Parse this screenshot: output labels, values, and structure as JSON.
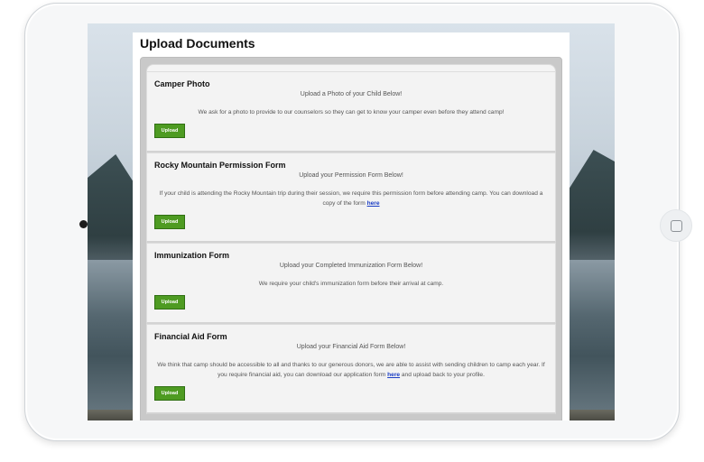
{
  "page": {
    "title": "Upload Documents"
  },
  "cards": [
    {
      "title": "Camper Photo",
      "subtitle": "Upload a Photo of your Child Below!",
      "desc_before": "We ask for a photo to provide to our counselors so they can get to know your camper even before they attend camp!",
      "link": "",
      "desc_after": "",
      "button": "Upload"
    },
    {
      "title": "Rocky Mountain Permission Form",
      "subtitle": "Upload your Permission Form Below!",
      "desc_before": "If your child is attending the Rocky Mountain trip during their session, we require this permission form before attending camp. You can download a copy of the form ",
      "link": "here",
      "desc_after": "",
      "button": "Upload"
    },
    {
      "title": "Immunization Form",
      "subtitle": "Upload your Completed Immunization Form Below!",
      "desc_before": "We require your child's immunization form before their arrival at camp.",
      "link": "",
      "desc_after": "",
      "button": "Upload"
    },
    {
      "title": "Financial Aid Form",
      "subtitle": "Upload your Financial Aid Form Below!",
      "desc_before": "We think that camp should be accessible to all and thanks to our generous donors, we are able to assist with sending children to camp each year. If you require financial aid, you can download our application form ",
      "link": "here",
      "desc_after": " and upload back to your profile.",
      "button": "Upload"
    }
  ],
  "colors": {
    "button_green": "#4e9b22",
    "link_blue": "#1a3dc4",
    "panel_gray": "#c9c9c9"
  }
}
